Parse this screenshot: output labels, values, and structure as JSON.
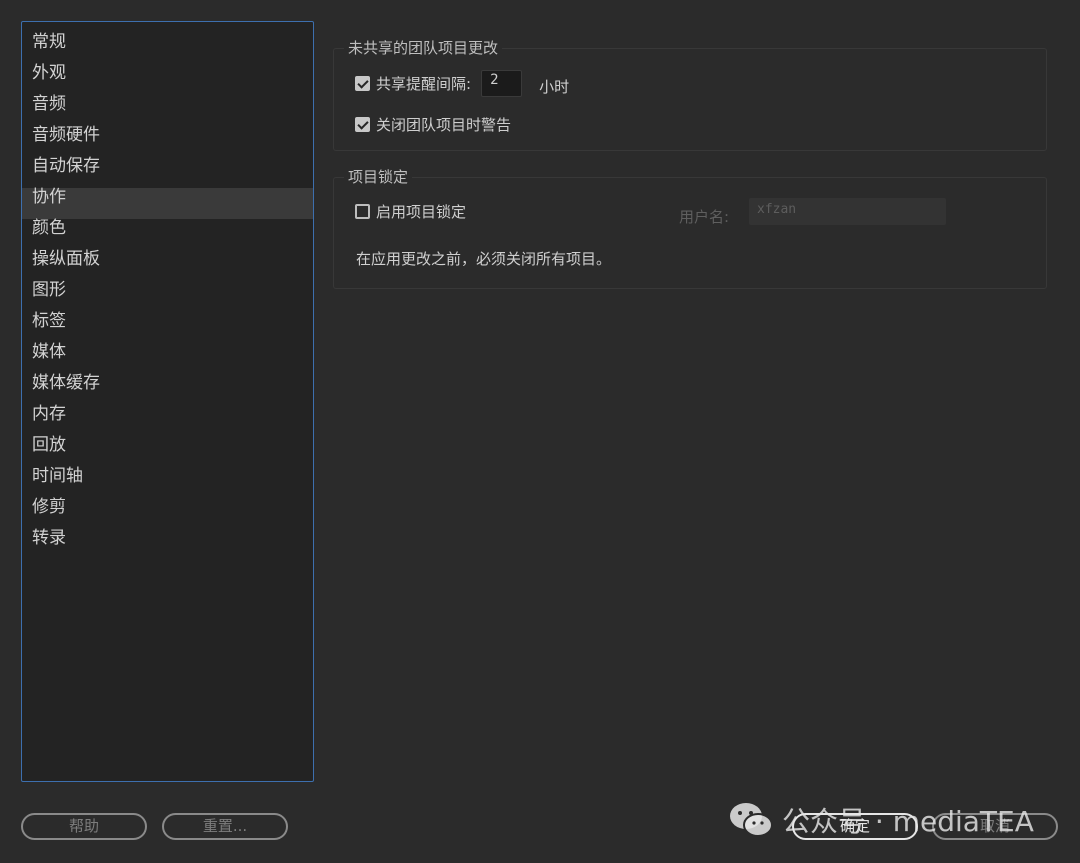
{
  "sidebar": {
    "items": [
      {
        "label": "常规"
      },
      {
        "label": "外观"
      },
      {
        "label": "音频"
      },
      {
        "label": "音频硬件"
      },
      {
        "label": "自动保存"
      },
      {
        "label": "协作",
        "active": true
      },
      {
        "label": "颜色"
      },
      {
        "label": "操纵面板"
      },
      {
        "label": "图形"
      },
      {
        "label": "标签"
      },
      {
        "label": "媒体"
      },
      {
        "label": "媒体缓存"
      },
      {
        "label": "内存"
      },
      {
        "label": "回放"
      },
      {
        "label": "时间轴"
      },
      {
        "label": "修剪"
      },
      {
        "label": "转录"
      }
    ]
  },
  "unshared_changes": {
    "title": "未共享的团队项目更改",
    "share_reminder_label": "共享提醒间隔:",
    "share_reminder_checked": true,
    "interval_value": "2",
    "interval_unit": "小时",
    "warn_on_close_label": "关闭团队项目时警告",
    "warn_on_close_checked": true
  },
  "project_lock": {
    "title": "项目锁定",
    "enable_label": "启用项目锁定",
    "enable_checked": false,
    "username_label": "用户名:",
    "username_value": "xfzan",
    "note": "在应用更改之前，必须关闭所有项目。"
  },
  "buttons": {
    "help": "帮助",
    "reset": "重置...",
    "ok": "确定",
    "cancel": "取消"
  },
  "watermark": {
    "text": "公众号 · mediaTEA",
    "icon": "wechat-icon"
  }
}
